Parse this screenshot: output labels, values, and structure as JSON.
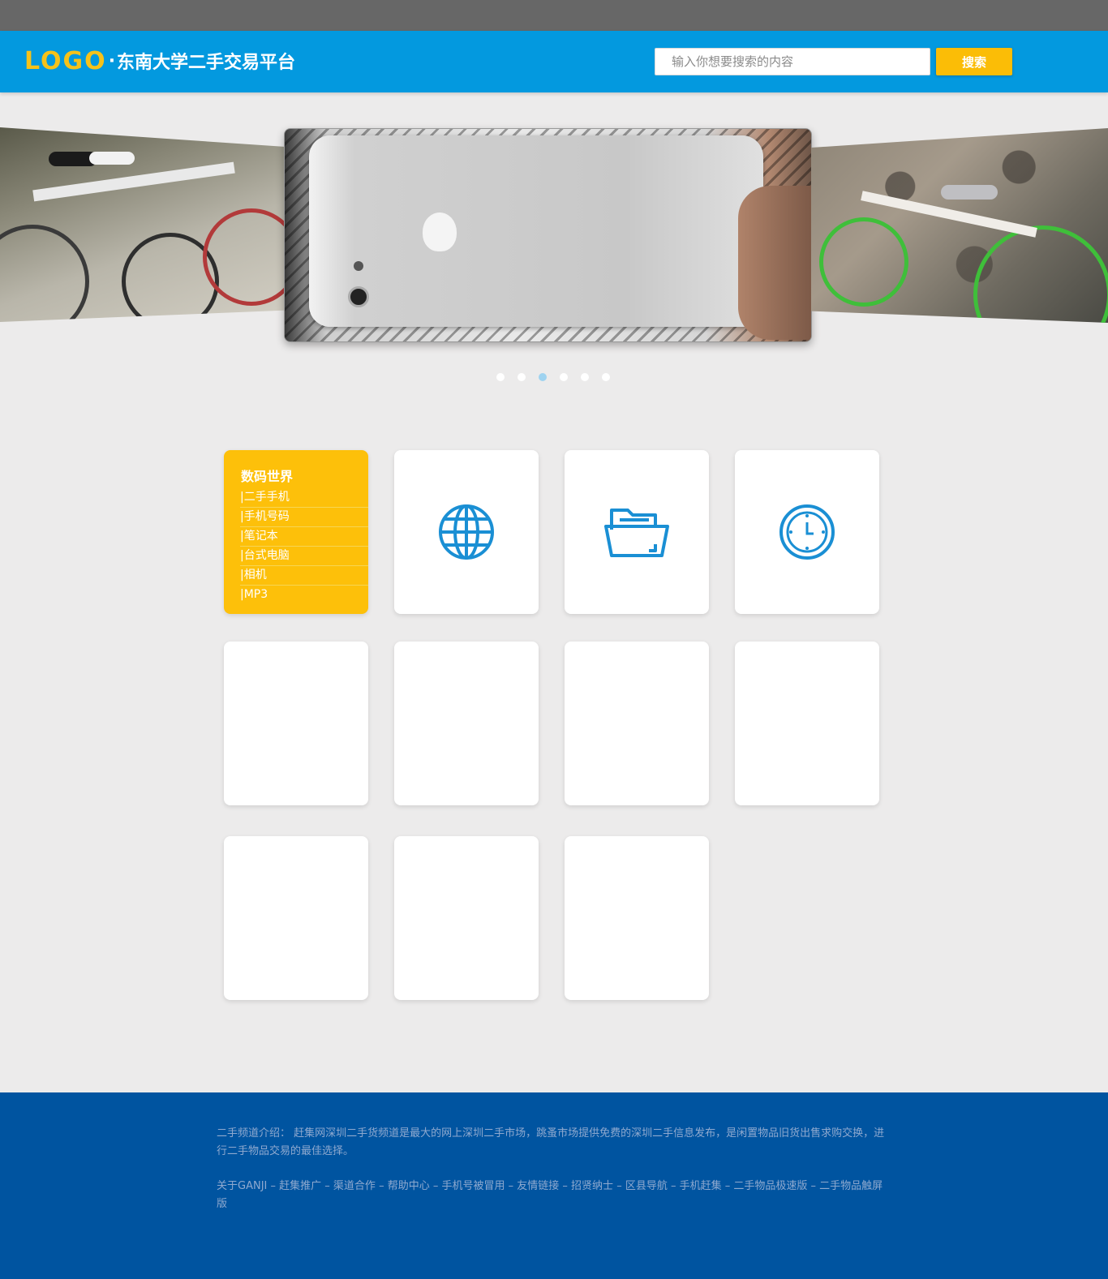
{
  "header": {
    "logo_mark": "LOGO",
    "logo_dot": "·",
    "site_title": "东南大学二手交易平台",
    "search_placeholder": "输入你想要搜索的内容",
    "search_button": "搜索"
  },
  "carousel": {
    "slide_count": 6,
    "active_index": 2,
    "slides": [
      "bicycles",
      "iphone",
      "bicycle"
    ]
  },
  "categories": {
    "digital": {
      "title": "数码世界",
      "items": [
        "|二手手机",
        "|手机号码",
        "|笔记本",
        "|台式电脑",
        "|相机",
        "|MP3"
      ]
    },
    "icons": [
      "globe-icon",
      "folder-icon",
      "clock-icon"
    ]
  },
  "colors": {
    "topbar": "#676767",
    "header": "#0399DF",
    "accent": "#FBBD06",
    "icon_blue": "#1A8FD4",
    "background": "#ECEBEB",
    "footer": "#0054A0"
  },
  "footer": {
    "intro": "二手频道介绍：  赶集网深圳二手货频道是最大的网上深圳二手市场，跳蚤市场提供免费的深圳二手信息发布，是闲置物品旧货出售求购交换，进行二手物品交易的最佳选择。",
    "links": [
      "关于GANJI",
      "赶集推广",
      "渠道合作",
      "帮助中心",
      "手机号被冒用",
      "友情链接",
      "招贤纳士",
      "区县导航",
      "手机赶集",
      "二手物品极速版",
      "二手物品触屏版"
    ]
  }
}
